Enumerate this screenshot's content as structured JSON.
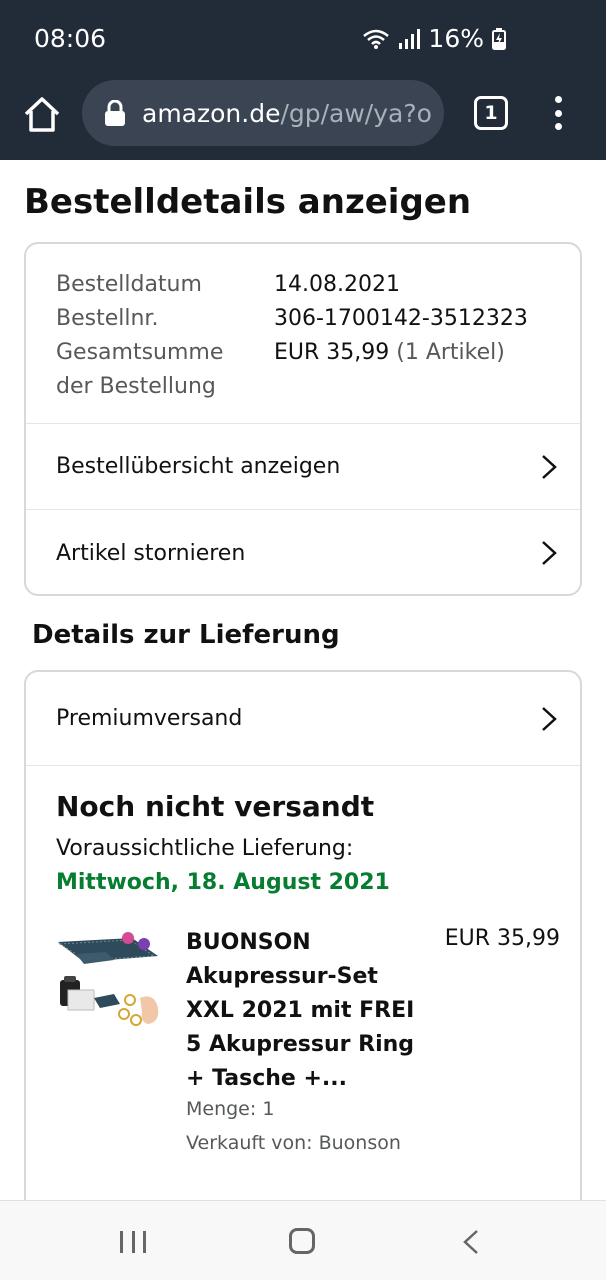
{
  "status_bar": {
    "time": "08:06",
    "battery": "16%"
  },
  "browser": {
    "url_host": "amazon.de",
    "url_path": "/gp/aw/ya?o",
    "tab_count": "1"
  },
  "page": {
    "title": "Bestelldetails anzeigen"
  },
  "order_summary": {
    "date_label": "Bestelldatum",
    "date_value": "14.08.2021",
    "number_label": "Bestellnr.",
    "number_value": "306-1700142-3512323",
    "total_label_line1": "Gesamtsumme",
    "total_label_line2": "der Bestellung",
    "total_value": "EUR 35,99",
    "total_items": "(1 Artikel)"
  },
  "order_actions": {
    "view_summary": "Bestellübersicht anzeigen",
    "cancel_items": "Artikel stornieren"
  },
  "delivery": {
    "section_title": "Details zur Lieferung",
    "shipping_method": "Premiumversand",
    "status": "Noch nicht versandt",
    "eta_label": "Voraussichtliche Lieferung:",
    "eta_date": "Mittwoch, 18. August 2021"
  },
  "product": {
    "title": "BUONSON Akupressur-Set XXL 2021 mit FREI 5 Akupressur Ring + Tasche +...",
    "price": "EUR 35,99",
    "quantity": "Menge: 1",
    "seller": "Verkauft von: Buonson"
  },
  "colors": {
    "chrome_bg": "#222b38",
    "url_bar_bg": "#3b4452",
    "eta_green": "#067d30",
    "muted_text": "#565959"
  }
}
